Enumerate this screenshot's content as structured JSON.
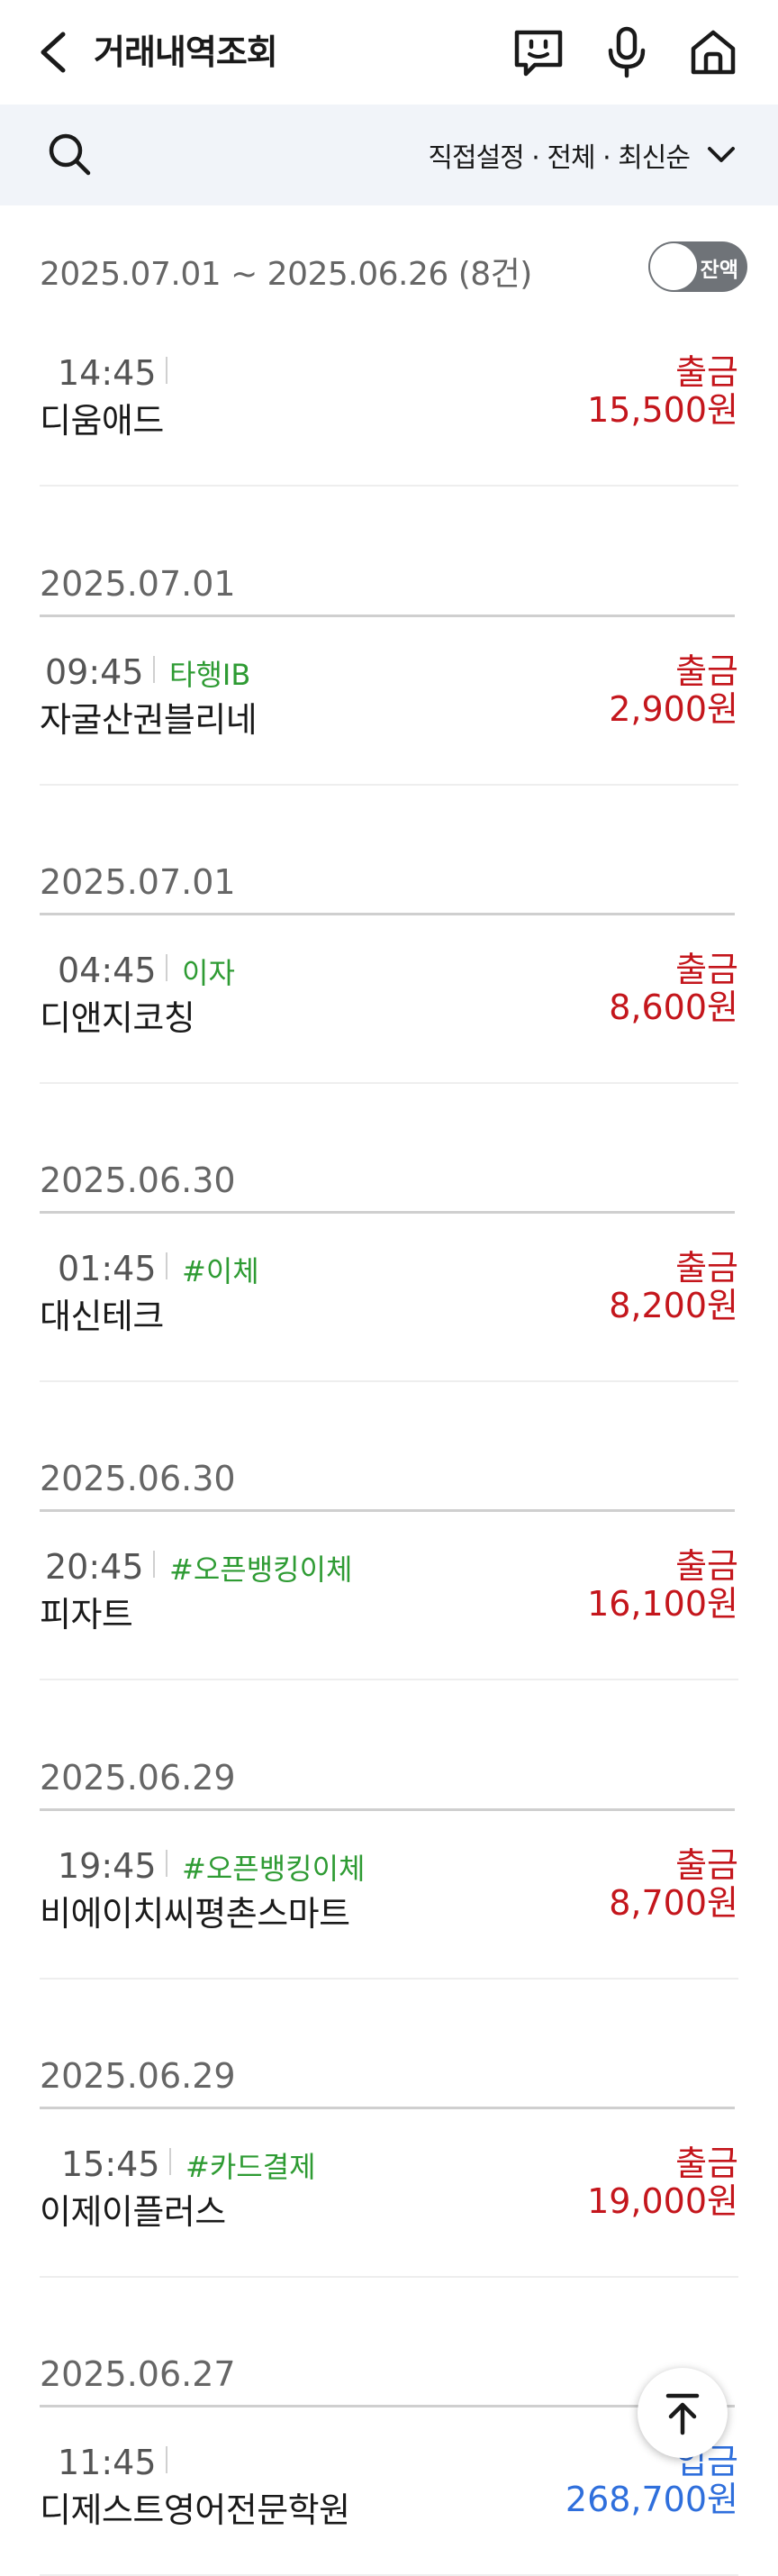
{
  "header": {
    "title": "거래내역조회",
    "icons": [
      "back-arrow-icon",
      "chatbot-icon",
      "microphone-icon",
      "home-icon"
    ]
  },
  "filter": {
    "label": "직접설정 · 전체 · 최신순"
  },
  "summary": {
    "range_text": "2025.07.01 ~ 2025.06.26 (8건)",
    "toggle_label": "잔액",
    "toggle_on": false
  },
  "colors": {
    "withdraw": "#c4161c",
    "deposit": "#2f6fdc",
    "tag": "#2e9b33"
  },
  "transactions": [
    {
      "time": "14:45",
      "tag": "",
      "name": "디움애드",
      "type": "출금",
      "amount": "15,500원",
      "direction": "out"
    },
    {
      "date": "2025.07.01",
      "time": "09:45",
      "tag": "타행IB",
      "name": "자굴산권블리네",
      "type": "출금",
      "amount": "2,900원",
      "direction": "out"
    },
    {
      "date": "2025.07.01",
      "time": "04:45",
      "tag": "이자",
      "name": "디앤지코칭",
      "type": "출금",
      "amount": "8,600원",
      "direction": "out"
    },
    {
      "date": "2025.06.30",
      "time": "01:45",
      "tag": "#이체",
      "name": "대신테크",
      "type": "출금",
      "amount": "8,200원",
      "direction": "out"
    },
    {
      "date": "2025.06.30",
      "time": "20:45",
      "tag": "#오픈뱅킹이체",
      "name": "피자트",
      "type": "출금",
      "amount": "16,100원",
      "direction": "out"
    },
    {
      "date": "2025.06.29",
      "time": "19:45",
      "tag": "#오픈뱅킹이체",
      "name": "비에이치씨평촌스마트",
      "type": "출금",
      "amount": "8,700원",
      "direction": "out"
    },
    {
      "date": "2025.06.29",
      "time": "15:45",
      "tag": "#카드결제",
      "name": "이제이플러스",
      "type": "출금",
      "amount": "19,000원",
      "direction": "out"
    },
    {
      "date": "2025.06.27",
      "time": "11:45",
      "tag": "",
      "name": "디제스트영어전문학원",
      "type": "입금",
      "amount": "268,700원",
      "direction": "in"
    }
  ]
}
